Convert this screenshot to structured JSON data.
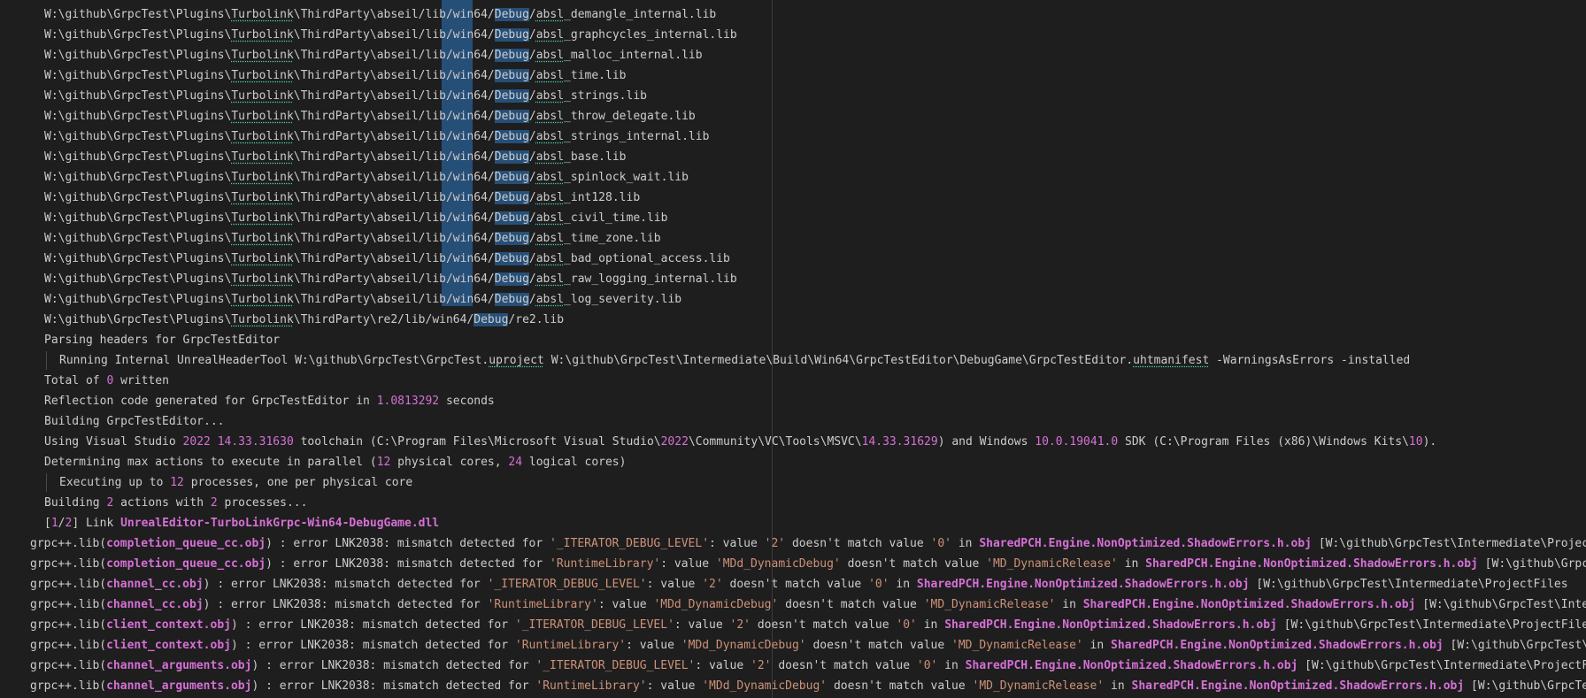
{
  "terminal": {
    "lib_prefix": "W:\\github\\GrpcTest\\Plugins\\",
    "lib_link": "Turbolink",
    "lib_mid": "\\ThirdParty\\abseil/lib/win64/",
    "lib_sel": "Debug",
    "lib_files": [
      {
        "pre": "/",
        "link": "absl",
        "rest": "_demangle_internal.lib"
      },
      {
        "pre": "/",
        "link": "absl",
        "rest": "_graphcycles_internal.lib"
      },
      {
        "pre": "/",
        "link": "absl",
        "rest": "_malloc_internal.lib"
      },
      {
        "pre": "/",
        "link": "absl",
        "rest": "_time.lib"
      },
      {
        "pre": "/",
        "link": "absl",
        "rest": "_strings.lib"
      },
      {
        "pre": "/",
        "link": "absl",
        "rest": "_throw_delegate.lib"
      },
      {
        "pre": "/",
        "link": "absl",
        "rest": "_strings_internal.lib"
      },
      {
        "pre": "/",
        "link": "absl",
        "rest": "_base.lib"
      },
      {
        "pre": "/",
        "link": "absl",
        "rest": "_spinlock_wait.lib"
      },
      {
        "pre": "/",
        "link": "absl",
        "rest": "_int128.lib"
      },
      {
        "pre": "/",
        "link": "absl",
        "rest": "_civil_time.lib"
      },
      {
        "pre": "/",
        "link": "absl",
        "rest": "_time_zone.lib"
      },
      {
        "pre": "/",
        "link": "absl",
        "rest": "_bad_optional_access.lib"
      },
      {
        "pre": "/",
        "link": "absl",
        "rest": "_raw_logging_internal.lib"
      },
      {
        "pre": "/",
        "link": "absl",
        "rest": "_log_severity.lib"
      }
    ],
    "re2_mid": "\\ThirdParty\\re2/lib/win64/",
    "re2_tail": "/re2.lib",
    "parsing": "Parsing headers for GrpcTestEditor",
    "uht_a": "Running Internal UnrealHeaderTool W:\\github\\GrpcTest\\GrpcTest.",
    "uht_link1": "uproject",
    "uht_b": " W:\\github\\GrpcTest\\Intermediate\\Build\\Win64\\GrpcTestEditor\\DebugGame\\GrpcTestEditor.",
    "uht_link2": "uhtmanifest",
    "uht_c": " -WarningsAsErrors -installed",
    "total_a": "Total of ",
    "total_n": "0",
    "total_b": " written",
    "refl_a": "Reflection code generated for GrpcTestEditor in ",
    "refl_n": "1.0813292",
    "refl_b": " seconds",
    "building": "Building GrpcTestEditor...",
    "vs_a": "Using Visual Studio ",
    "vs_n1": "2022",
    "vs_sp": " ",
    "vs_n2": "14.33.31630",
    "vs_b": " toolchain (C:\\Program Files\\Microsoft Visual Studio\\",
    "vs_n3": "2022",
    "vs_c": "\\Community\\VC\\Tools\\MSVC\\",
    "vs_n4": "14.33.31629",
    "vs_d": ") and Windows ",
    "vs_n5": "10.0.19041.0",
    "vs_e": " SDK (C:\\Program Files (x86)\\Windows Kits\\",
    "vs_n6": "10",
    "vs_f": ").",
    "det_a": "Determining max actions to execute in parallel (",
    "det_n1": "12",
    "det_b": " physical cores, ",
    "det_n2": "24",
    "det_c": " logical cores)",
    "exec_a": "Executing up to ",
    "exec_n": "12",
    "exec_b": " processes, one per physical core",
    "ba_a": "Building ",
    "ba_n1": "2",
    "ba_b": " actions with ",
    "ba_n2": "2",
    "ba_c": " processes...",
    "link_open": "[",
    "link_n1": "1",
    "link_slash": "/",
    "link_n2": "2",
    "link_close": "] Link ",
    "link_dll": "UnrealEditor-TurboLinkGrpc-Win64-DebugGame.dll",
    "err_lib": "grpc++.lib(",
    "err_mid": ") : error LNK2038: mismatch detected for ",
    "err_val": ": value ",
    "err_dm": " doesn't match value ",
    "err_in": " in ",
    "err_pch": "SharedPCH.Engine.NonOptimized.ShadowErrors.h.obj",
    "errors": [
      {
        "obj": "completion_queue_cc.obj",
        "key": "'_ITERATOR_DEBUG_LEVEL'",
        "v1": "'2'",
        "v2": "'0'",
        "tail": " [W:\\github\\GrpcTest\\Intermediate\\ProjectFiles"
      },
      {
        "obj": "completion_queue_cc.obj",
        "key": "'RuntimeLibrary'",
        "v1": "'MDd_DynamicDebug'",
        "v2": "'MD_DynamicRelease'",
        "tail": " [W:\\github\\GrpcTest\\Intermediate"
      },
      {
        "obj": "channel_cc.obj",
        "key": "'_ITERATOR_DEBUG_LEVEL'",
        "v1": "'2'",
        "v2": "'0'",
        "tail": " [W:\\github\\GrpcTest\\Intermediate\\ProjectFiles"
      },
      {
        "obj": "channel_cc.obj",
        "key": "'RuntimeLibrary'",
        "v1": "'MDd_DynamicDebug'",
        "v2": "'MD_DynamicRelease'",
        "tail": " [W:\\github\\GrpcTest\\Intermediate"
      },
      {
        "obj": "client_context.obj",
        "key": "'_ITERATOR_DEBUG_LEVEL'",
        "v1": "'2'",
        "v2": "'0'",
        "tail": " [W:\\github\\GrpcTest\\Intermediate\\ProjectFiles"
      },
      {
        "obj": "client_context.obj",
        "key": "'RuntimeLibrary'",
        "v1": "'MDd_DynamicDebug'",
        "v2": "'MD_DynamicRelease'",
        "tail": " [W:\\github\\GrpcTest\\Intermediate"
      },
      {
        "obj": "channel_arguments.obj",
        "key": "'_ITERATOR_DEBUG_LEVEL'",
        "v1": "'2'",
        "v2": "'0'",
        "tail": " [W:\\github\\GrpcTest\\Intermediate\\ProjectFiles"
      },
      {
        "obj": "channel_arguments.obj",
        "key": "'RuntimeLibrary'",
        "v1": "'MDd_DynamicDebug'",
        "v2": "'MD_DynamicRelease'",
        "tail": " [W:\\github\\GrpcTest\\Intermediate"
      }
    ]
  }
}
